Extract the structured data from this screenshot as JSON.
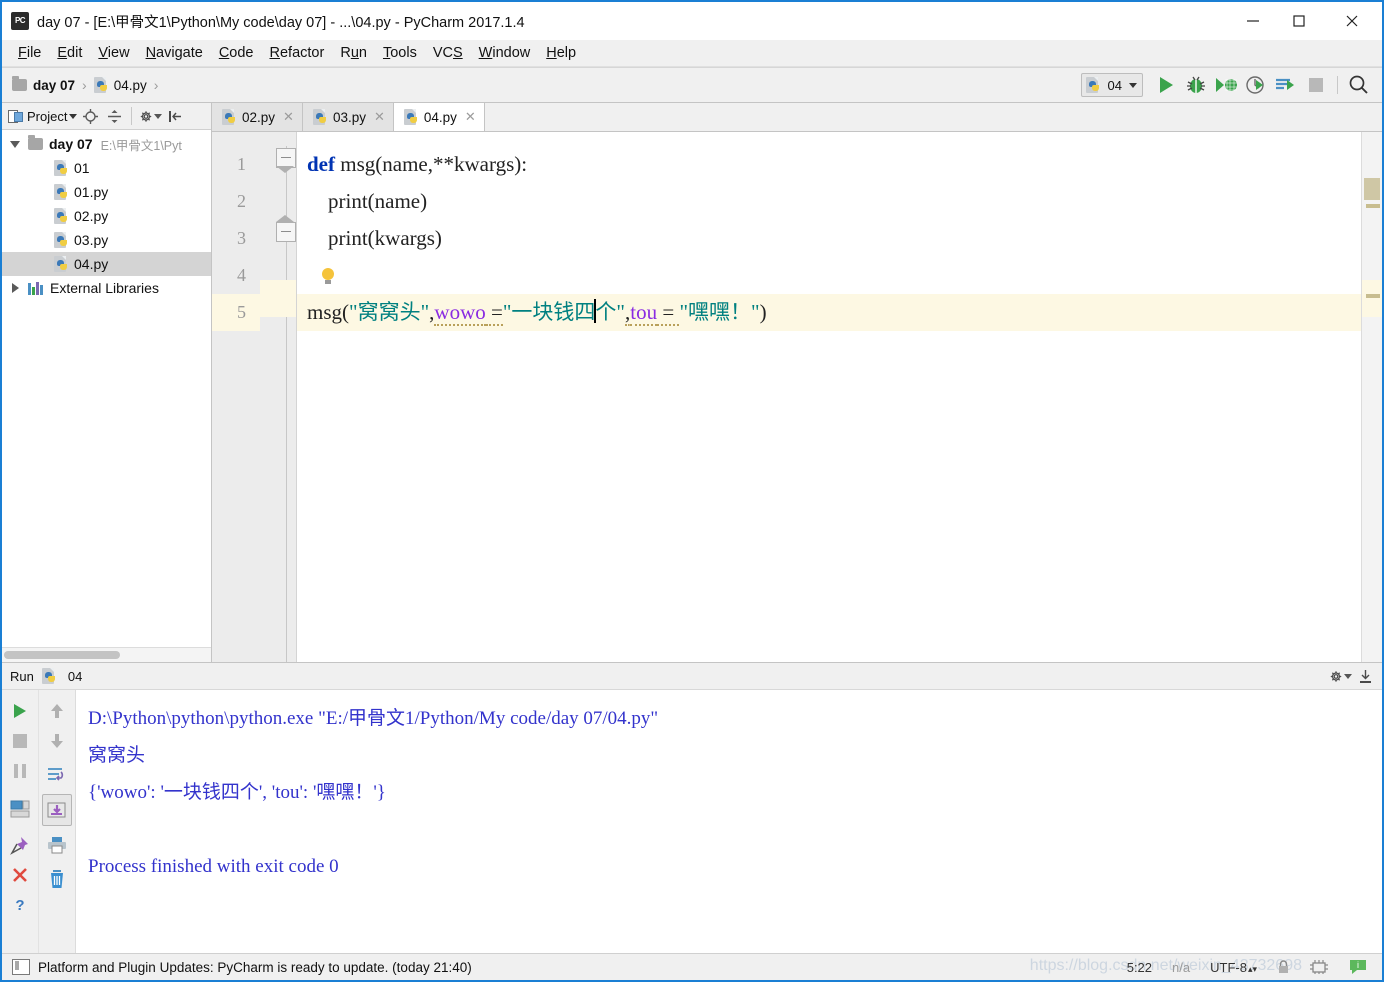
{
  "window": {
    "title": "day 07 - [E:\\甲骨文1\\Python\\My code\\day 07] - ...\\04.py - PyCharm 2017.1.4",
    "app_icon": "PC",
    "minimize": "—",
    "maximize": "☐",
    "close": "✕"
  },
  "menu": {
    "items": [
      {
        "pre": "",
        "key": "F",
        "post": "ile"
      },
      {
        "pre": "",
        "key": "E",
        "post": "dit"
      },
      {
        "pre": "",
        "key": "V",
        "post": "iew"
      },
      {
        "pre": "",
        "key": "N",
        "post": "avigate"
      },
      {
        "pre": "",
        "key": "C",
        "post": "ode"
      },
      {
        "pre": "",
        "key": "R",
        "post": "efactor"
      },
      {
        "pre": "R",
        "key": "u",
        "post": "n"
      },
      {
        "pre": "",
        "key": "T",
        "post": "ools"
      },
      {
        "pre": "VC",
        "key": "S",
        "post": ""
      },
      {
        "pre": "",
        "key": "W",
        "post": "indow"
      },
      {
        "pre": "",
        "key": "H",
        "post": "elp"
      }
    ]
  },
  "breadcrumb": {
    "folder": "day 07",
    "separator": "›",
    "file": "04.py"
  },
  "toolbar": {
    "run_config": "04",
    "dropdown_caret": "▾",
    "buttons": [
      {
        "name": "run-button",
        "label": "Run"
      },
      {
        "name": "debug-button",
        "label": "Debug"
      },
      {
        "name": "coverage-button",
        "label": "Run with Coverage"
      },
      {
        "name": "profile-button",
        "label": "Profile"
      },
      {
        "name": "attach-button",
        "label": "Attach to Process"
      },
      {
        "name": "stop-button",
        "label": "Stop"
      },
      {
        "name": "search-button",
        "label": "Search Everywhere"
      }
    ]
  },
  "sidebar": {
    "toolbar": {
      "title": "Project",
      "caret": "▾",
      "locate_label": "Select Opened File",
      "collapse_label": "Collapse All",
      "settings_label": "Settings",
      "hide_label": "Hide"
    },
    "tree": [
      {
        "label": "day 07",
        "path": "E:\\甲骨文1\\Pyt",
        "type": "folder",
        "expanded": true,
        "selected": false
      },
      {
        "label": "01",
        "path": "",
        "type": "py",
        "selected": false
      },
      {
        "label": "01.py",
        "path": "",
        "type": "py",
        "selected": false
      },
      {
        "label": "02.py",
        "path": "",
        "type": "py",
        "selected": false
      },
      {
        "label": "03.py",
        "path": "",
        "type": "py",
        "selected": false
      },
      {
        "label": "04.py",
        "path": "",
        "type": "py",
        "selected": true
      },
      {
        "label": "External Libraries",
        "path": "",
        "type": "lib",
        "expanded": false,
        "selected": false
      }
    ]
  },
  "editor": {
    "tabs": [
      {
        "label": "02.py",
        "close": "✕",
        "active": false
      },
      {
        "label": "03.py",
        "close": "✕",
        "active": false
      },
      {
        "label": "04.py",
        "close": "✕",
        "active": true
      }
    ],
    "line_numbers": [
      "1",
      "2",
      "3",
      "4",
      "5"
    ],
    "current_line": 5,
    "code": {
      "l1_kw": "def",
      "l1_rest": " msg(name,**kwargs):",
      "l2": "    print(name)",
      "l3": "    print(kwargs)",
      "l4": "",
      "l5_a": "msg(",
      "l5_str1": "\"窝窝头\"",
      "l5_comma1": ",",
      "l5_kwarg1": "wowo",
      "l5_eq1": " =",
      "l5_str2a": "\"一块钱四",
      "l5_str2b": "个\"",
      "l5_comma2": ",",
      "l5_kwarg2": "tou",
      "l5_eq2": " = ",
      "l5_str3": "\"嘿嘿！\"",
      "l5_end": ")"
    },
    "intention_bulb": "lightbulb-icon"
  },
  "run_panel": {
    "title": "Run",
    "config_name": "04",
    "tools_left": [
      {
        "name": "rerun-button",
        "label": "Rerun"
      },
      {
        "name": "stop-button",
        "label": "Stop"
      },
      {
        "name": "pause-button",
        "label": "Pause Output"
      },
      {
        "name": "restore-layout-button",
        "label": "Restore Layout"
      },
      {
        "name": "pin-tab-button",
        "label": "Pin Tab"
      },
      {
        "name": "close-button",
        "label": "Close"
      },
      {
        "name": "help-button",
        "label": "Help"
      }
    ],
    "tools_right": [
      {
        "name": "up-stack-button",
        "label": "Up the Stack Trace"
      },
      {
        "name": "down-stack-button",
        "label": "Down the Stack Trace"
      },
      {
        "name": "soft-wrap-button",
        "label": "Use Soft Wraps"
      },
      {
        "name": "scroll-to-end-button",
        "label": "Scroll to End"
      },
      {
        "name": "print-button",
        "label": "Print"
      },
      {
        "name": "clear-all-button",
        "label": "Clear All"
      }
    ],
    "header_right": [
      {
        "name": "gear-icon",
        "label": "Settings"
      },
      {
        "name": "hide-icon",
        "label": "Hide"
      }
    ],
    "output": [
      "D:\\Python\\python\\python.exe \"E:/甲骨文1/Python/My code/day 07/04.py\"",
      "窝窝头",
      "{'wowo': '一块钱四个', 'tou': '嘿嘿！'}",
      "",
      "Process finished with exit code 0"
    ]
  },
  "status_bar": {
    "message": "Platform and Plugin Updates: PyCharm is ready to update. (today 21:40)",
    "caret_position": "5:22",
    "line_separator": "n/a",
    "encoding": "UTF-8",
    "encoding_caret": "▴▾",
    "lock_icon": "lock-icon",
    "watermark": "https://blog.csdn.net/weixin_43732698"
  },
  "colors": {
    "accent_blue": "#1a7fd4",
    "keyword": "#0033b3",
    "string": "#008080",
    "kwarg": "#8a2be2",
    "console_text": "#3333cc",
    "current_line": "#fdf8e3",
    "selection": "#d4d4d4"
  }
}
